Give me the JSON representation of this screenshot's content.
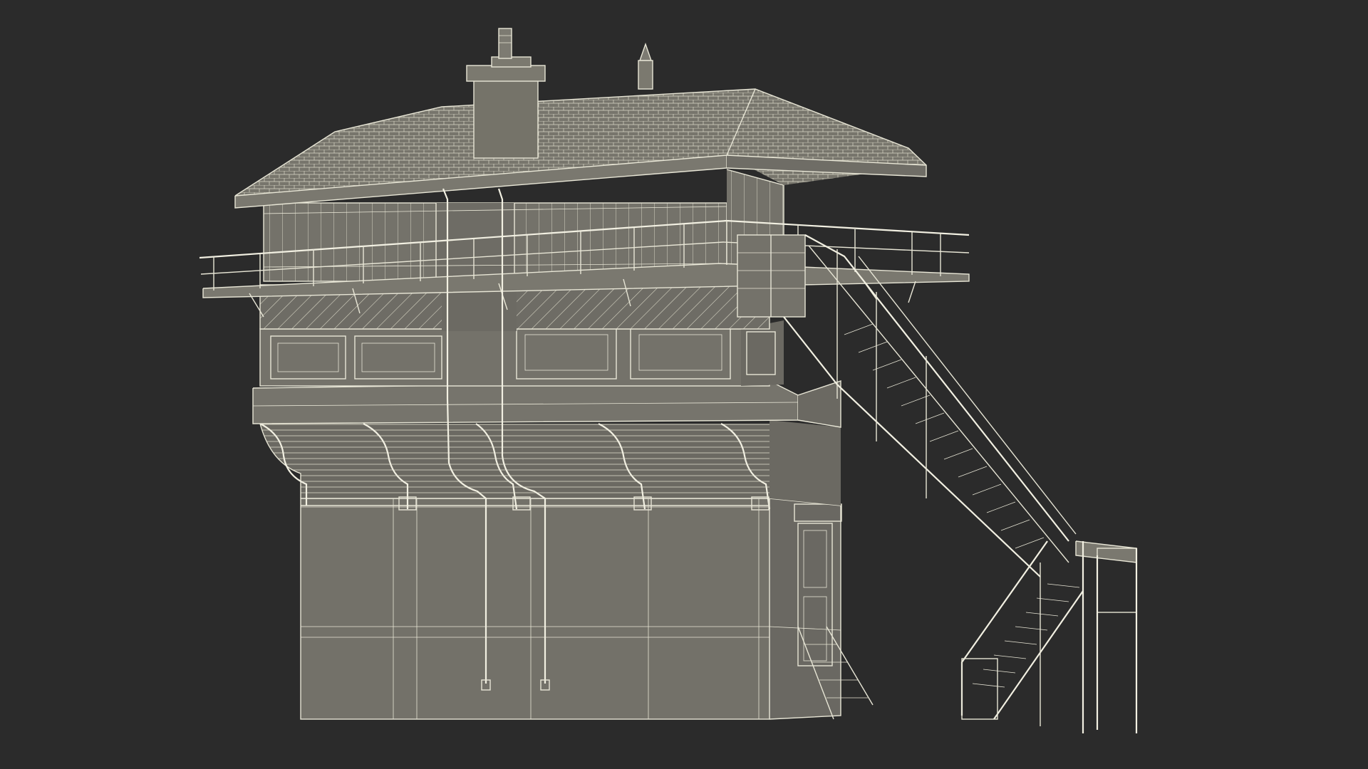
{
  "scene": {
    "subject": "signal-box-wireframe-model",
    "background_color": "#2b2b2b",
    "surface_color": "#727068",
    "wire_color": "#e8e6d6"
  }
}
